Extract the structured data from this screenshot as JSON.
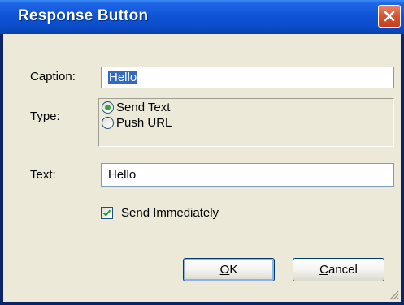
{
  "window": {
    "title": "Response Button"
  },
  "form": {
    "caption_label": "Caption:",
    "caption_value": "Hello",
    "type_label": "Type:",
    "type_options": [
      "Send Text",
      "Push URL"
    ],
    "type_selected": "Send Text",
    "text_label": "Text:",
    "text_value": "Hello",
    "send_immediately_label": "Send Immediately",
    "send_immediately_checked": true
  },
  "buttons": {
    "ok_mnemonic": "O",
    "ok_rest": "K",
    "cancel_mnemonic": "C",
    "cancel_rest": "ancel"
  },
  "colors": {
    "title_bar": "#0b4cc8",
    "dialog_face": "#ece9d8",
    "close_button": "#d8532f",
    "selection": "#316ac5",
    "radio_checkmark": "#3fa03f"
  },
  "icons": {
    "close": "close-icon",
    "resize": "resize-grip-icon",
    "check": "checkmark-icon"
  }
}
